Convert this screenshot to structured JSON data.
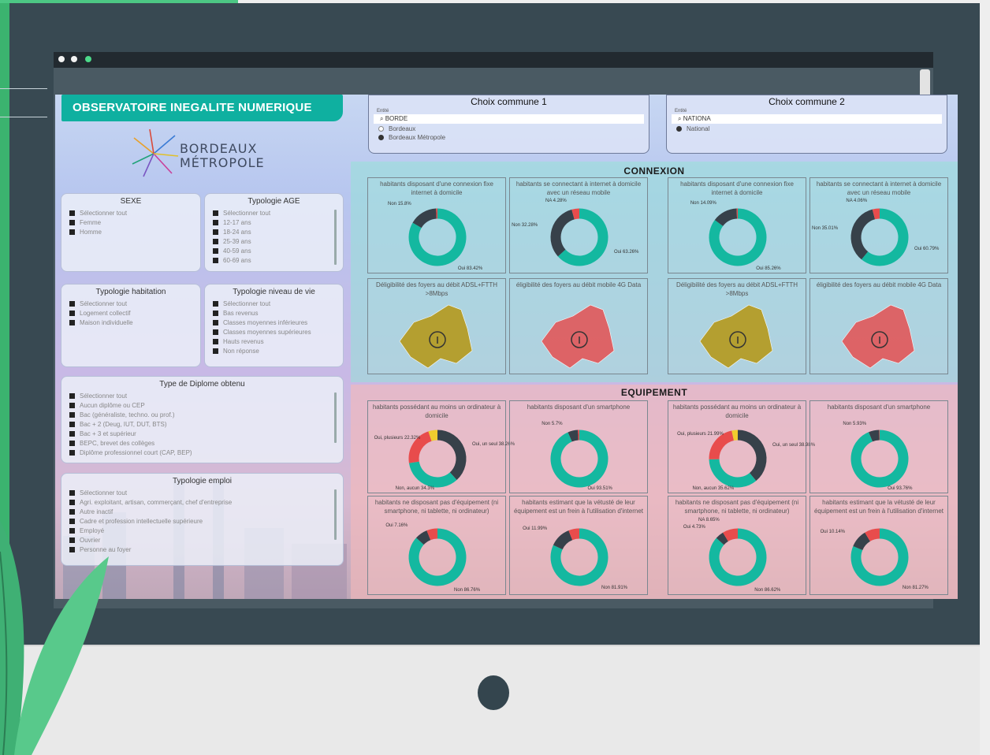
{
  "dashboard": {
    "title": "OBSERVATOIRE INEGALITE NUMERIQUE",
    "logo_line1": "BORDEAUX",
    "logo_line2": "MÉTROPOLE"
  },
  "commune1": {
    "heading": "Choix commune 1",
    "entite_label": "Entité",
    "search_value": "BORDE",
    "options": [
      "Bordeaux",
      "Bordeaux Métropole"
    ],
    "selected": "Bordeaux Métropole"
  },
  "commune2": {
    "heading": "Choix commune 2",
    "entite_label": "Entité",
    "search_value": "NATIONA",
    "options": [
      "National"
    ],
    "selected": "National"
  },
  "filters": {
    "sexe": {
      "title": "SEXE",
      "items": [
        "Sélectionner tout",
        "Femme",
        "Homme"
      ]
    },
    "age": {
      "title": "Typologie AGE",
      "items": [
        "Sélectionner tout",
        "12-17 ans",
        "18-24 ans",
        "25-39 ans",
        "40-59 ans",
        "60-69 ans"
      ]
    },
    "habitation": {
      "title": "Typologie habitation",
      "items": [
        "Sélectionner tout",
        "Logement collectif",
        "Maison individuelle"
      ]
    },
    "niveau_vie": {
      "title": "Typologie niveau de vie",
      "items": [
        "Sélectionner tout",
        "Bas revenus",
        "Classes moyennes inférieures",
        "Classes moyennes supérieures",
        "Hauts revenus",
        "Non réponse"
      ]
    },
    "diplome": {
      "title": "Type de Diplome obtenu",
      "items": [
        "Sélectionner tout",
        "Aucun diplôme ou CEP",
        "Bac (généraliste, techno. ou prof.)",
        "Bac + 2 (Deug, IUT, DUT, BTS)",
        "Bac + 3 et supérieur",
        "BEPC, brevet des collèges",
        "Diplôme professionnel court (CAP, BEP)"
      ]
    },
    "emploi": {
      "title": "Typologie emploi",
      "items": [
        "Sélectionner tout",
        "Agri. exploitant, artisan, commerçant, chef d'entreprise",
        "Autre inactif",
        "Cadre et profession intellectuelle supérieure",
        "Employé",
        "Ouvrier",
        "Personne au foyer"
      ]
    }
  },
  "connexion": {
    "title": "CONNEXION",
    "cards": [
      {
        "title": "habitants disposant d'une connexion fixe internet à domicile",
        "slices": [
          {
            "label": "Oui 83.42%",
            "value": 83.42,
            "color": "#14b8a0"
          },
          {
            "label": "Non 15.8%",
            "value": 15.8,
            "color": "#37414a"
          },
          {
            "label": "",
            "value": 0.78,
            "color": "#e84c4c"
          }
        ]
      },
      {
        "title": "habitants se connectant à internet à domicile avec un réseau mobile",
        "slices": [
          {
            "label": "Oui 63.26%",
            "value": 63.26,
            "color": "#14b8a0"
          },
          {
            "label": "Non 32.28%",
            "value": 32.28,
            "color": "#37414a"
          },
          {
            "label": "NA 4.28%",
            "value": 4.28,
            "color": "#e84c4c"
          }
        ]
      },
      {
        "title": "habitants disposant d'une connexion fixe internet à domicile",
        "slices": [
          {
            "label": "Oui 85.26%",
            "value": 85.26,
            "color": "#14b8a0"
          },
          {
            "label": "Non 14.09%",
            "value": 14.09,
            "color": "#37414a"
          },
          {
            "label": "",
            "value": 0.65,
            "color": "#e84c4c"
          }
        ]
      },
      {
        "title": "habitants se connectant à internet à domicile avec un réseau mobile",
        "slices": [
          {
            "label": "Oui 60.79%",
            "value": 60.79,
            "color": "#14b8a0"
          },
          {
            "label": "Non 35.01%",
            "value": 35.01,
            "color": "#37414a"
          },
          {
            "label": "NA 4.06%",
            "value": 4.06,
            "color": "#e84c4c"
          }
        ]
      }
    ],
    "maps": [
      {
        "title": "Déligibilité des foyers au débit ADSL+FTTH >8Mbps",
        "color": "#b59a1e"
      },
      {
        "title": "éligibilité des foyers au débit mobile 4G Data",
        "color": "#e2585a"
      },
      {
        "title": "Déligibilité des foyers au débit ADSL+FTTH >8Mbps",
        "color": "#b59a1e"
      },
      {
        "title": "éligibilité des foyers au débit mobile 4G Data",
        "color": "#e2585a"
      }
    ]
  },
  "equipement": {
    "title": "EQUIPEMENT",
    "cards": [
      {
        "title": "habitants possédant au moins un ordinateur à domicile",
        "slices": [
          {
            "label": "Oui, un seul 38.26%",
            "value": 38.26,
            "color": "#37414a"
          },
          {
            "label": "Non, aucun 34.3%",
            "value": 34.3,
            "color": "#14b8a0"
          },
          {
            "label": "Oui, plusieurs 22.32%",
            "value": 22.32,
            "color": "#e84c4c"
          },
          {
            "label": "",
            "value": 5.12,
            "color": "#f0cc2e"
          }
        ]
      },
      {
        "title": "habitants disposant d'un smartphone",
        "slices": [
          {
            "label": "Oui 93.51%",
            "value": 93.51,
            "color": "#14b8a0"
          },
          {
            "label": "Non 5.7%",
            "value": 5.7,
            "color": "#37414a"
          },
          {
            "label": "",
            "value": 0.79,
            "color": "#e84c4c"
          }
        ]
      },
      {
        "title": "habitants possédant au moins un ordinateur à domicile",
        "slices": [
          {
            "label": "Oui, un seul 38.98%",
            "value": 38.98,
            "color": "#37414a"
          },
          {
            "label": "Non, aucun 35.62%",
            "value": 35.62,
            "color": "#14b8a0"
          },
          {
            "label": "Oui, plusieurs 21.99%",
            "value": 21.99,
            "color": "#e84c4c"
          },
          {
            "label": "",
            "value": 3.41,
            "color": "#f0cc2e"
          }
        ]
      },
      {
        "title": "habitants disposant d'un smartphone",
        "slices": [
          {
            "label": "Oui 93.76%",
            "value": 93.76,
            "color": "#14b8a0"
          },
          {
            "label": "Non 5.93%",
            "value": 5.93,
            "color": "#37414a"
          },
          {
            "label": "",
            "value": 0.31,
            "color": "#e84c4c"
          }
        ]
      },
      {
        "title": "habitants ne disposant pas d'équipement (ni smartphone, ni tablette, ni ordinateur)",
        "slices": [
          {
            "label": "Non 86.76%",
            "value": 86.76,
            "color": "#14b8a0"
          },
          {
            "label": "Oui 7.16%",
            "value": 7.16,
            "color": "#37414a"
          },
          {
            "label": "",
            "value": 6.08,
            "color": "#e84c4c"
          }
        ]
      },
      {
        "title": "habitants estimant que la vétusté de leur équipement est un frein à l'utilisation d'internet",
        "slices": [
          {
            "label": "Non 81.91%",
            "value": 81.91,
            "color": "#14b8a0"
          },
          {
            "label": "Oui 11.99%",
            "value": 11.99,
            "color": "#37414a"
          },
          {
            "label": "",
            "value": 6.1,
            "color": "#e84c4c"
          }
        ]
      },
      {
        "title": "habitants ne disposant pas d'équipement (ni smartphone, ni tablette, ni ordinateur)",
        "slices": [
          {
            "label": "Non 86.62%",
            "value": 86.62,
            "color": "#14b8a0"
          },
          {
            "label": "Oui 4.73%",
            "value": 4.73,
            "color": "#37414a"
          },
          {
            "label": "NA 8.65%",
            "value": 8.65,
            "color": "#e84c4c"
          }
        ]
      },
      {
        "title": "habitants estimant que la vétusté de leur équipement est un frein à l'utilisation d'internet",
        "slices": [
          {
            "label": "Non 81.27%",
            "value": 81.27,
            "color": "#14b8a0"
          },
          {
            "label": "Oui 10.14%",
            "value": 10.14,
            "color": "#37414a"
          },
          {
            "label": "",
            "value": 8.59,
            "color": "#e84c4c"
          }
        ]
      }
    ]
  },
  "colors": {
    "accent": "#0fb0a0",
    "monitor": "#384952",
    "leaf": "#56c98c"
  }
}
